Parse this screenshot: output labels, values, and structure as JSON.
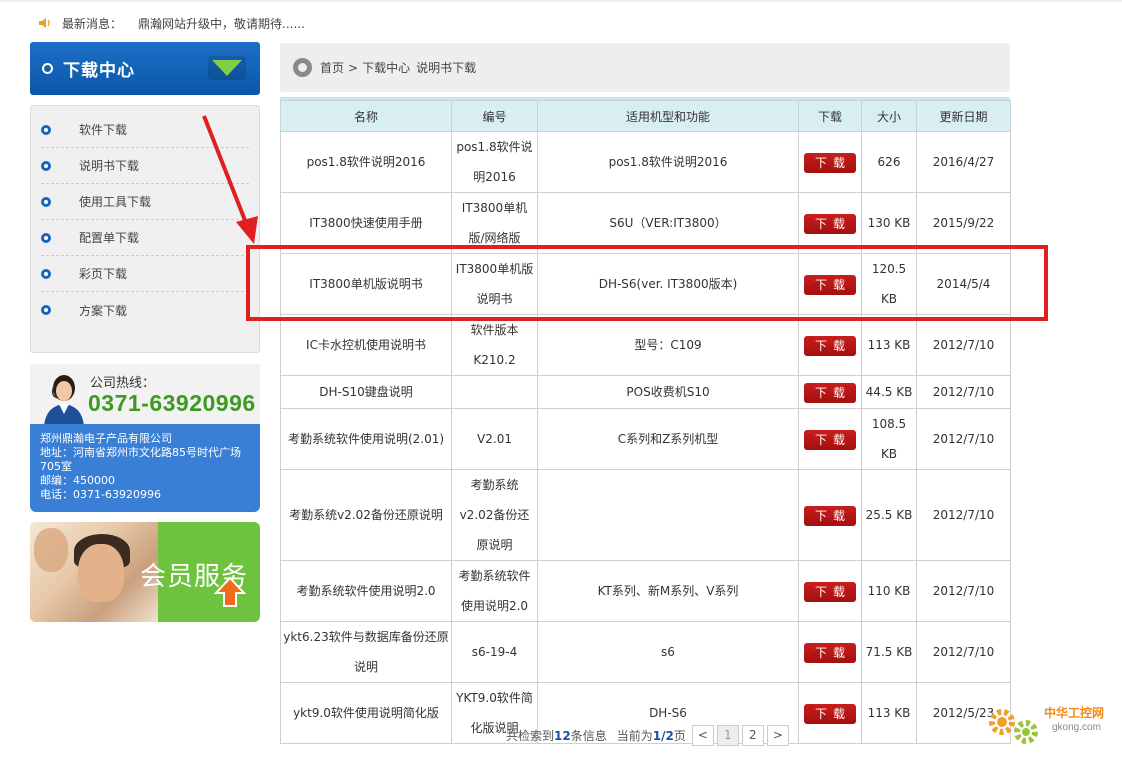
{
  "notice": {
    "label": "最新消息：",
    "text": "鼎瀚网站升级中，敬请期待......"
  },
  "sidebar": {
    "title": "下载中心",
    "items": [
      {
        "label": "软件下载"
      },
      {
        "label": "说明书下载"
      },
      {
        "label": "使用工具下载"
      },
      {
        "label": "配置单下载"
      },
      {
        "label": "彩页下载"
      },
      {
        "label": "方案下载"
      }
    ],
    "hotline_label": "公司热线：",
    "hotline_number": "0371-63920996",
    "contact": {
      "company": "郑州鼎瀚电子产品有限公司",
      "address": "地址：河南省郑州市文化路85号时代广场705室",
      "postcode": "邮编：450000",
      "phone": "电话：0371-63920996"
    },
    "member_banner": "会员服务"
  },
  "breadcrumb": {
    "home": "首页",
    "sep": ">",
    "section": "下载中心",
    "current": "说明书下载"
  },
  "table": {
    "headers": [
      "名称",
      "编号",
      "适用机型和功能",
      "下载",
      "大小",
      "更新日期"
    ],
    "download_label": "下载",
    "rows": [
      {
        "name": "pos1.8软件说明2016",
        "code": "pos1.8软件说明2016",
        "model": "pos1.8软件说明2016",
        "size": "626",
        "date": "2016/4/27"
      },
      {
        "name": "IT3800快速使用手册",
        "code": "IT3800单机版/网络版",
        "model": "S6U（VER:IT3800）",
        "size": "130 KB",
        "date": "2015/9/22"
      },
      {
        "name": "IT3800单机版说明书",
        "code": "IT3800单机版说明书",
        "model": "DH-S6(ver. IT3800版本)",
        "size": "120.5 KB",
        "date": "2014/5/4"
      },
      {
        "name": "IC卡水控机使用说明书",
        "code": "软件版本K210.2",
        "model": "型号：C109",
        "size": "113 KB",
        "date": "2012/7/10"
      },
      {
        "name": "DH-S10键盘说明",
        "code": "",
        "model": "POS收费机S10",
        "size": "44.5 KB",
        "date": "2012/7/10"
      },
      {
        "name": "考勤系统软件使用说明(2.01)",
        "code": "V2.01",
        "model": "C系列和Z系列机型",
        "size": "108.5 KB",
        "date": "2012/7/10"
      },
      {
        "name": "考勤系统v2.02备份还原说明",
        "code": "考勤系统v2.02备份还原说明",
        "model": "",
        "size": "25.5 KB",
        "date": "2012/7/10"
      },
      {
        "name": "考勤系统软件使用说明2.0",
        "code": "考勤系统软件使用说明2.0",
        "model": "KT系列、新M系列、V系列",
        "size": "110 KB",
        "date": "2012/7/10"
      },
      {
        "name": "ykt6.23软件与数据库备份还原说明",
        "code": "s6-19-4",
        "model": "s6",
        "size": "71.5 KB",
        "date": "2012/7/10"
      },
      {
        "name": "ykt9.0软件使用说明简化版",
        "code": "YKT9.0软件简化版说明",
        "model": "DH-S6",
        "size": "113 KB",
        "date": "2012/5/23"
      }
    ]
  },
  "pager": {
    "prefix": "共检索到",
    "total": "12",
    "suffix": "条信息",
    "cur_prefix": "当前为",
    "current": "1/2",
    "cur_suffix": "页",
    "prev": "<",
    "pages": [
      "1",
      "2"
    ],
    "next": ">"
  },
  "watermark": {
    "title": "中华工控网",
    "url": "gkong.com"
  },
  "colors": {
    "brand_blue": "#0a57a9",
    "download_red": "#b71515",
    "highlight_red": "#e02020",
    "hotline_green": "#3c9a20"
  }
}
